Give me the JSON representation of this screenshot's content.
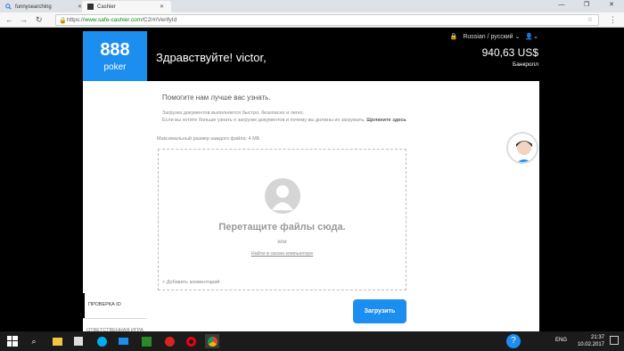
{
  "browser": {
    "tabs": [
      {
        "label": "funnysearching"
      },
      {
        "label": "Cashier"
      }
    ],
    "url_prefix": "https://",
    "url_host": "www.safe-cashier.com",
    "url_path": "/C2/#/VerifyId"
  },
  "header": {
    "greeting": "Здравствуйте! victor,",
    "language": "Russian / русский",
    "balance": "940,63 US$",
    "balance_label": "Банкролл",
    "logo_top": "888",
    "logo_bottom": "poker"
  },
  "sidebar": {
    "items": [
      {
        "label": "ПРОВЕРКА ID"
      },
      {
        "label": "ОТВЕТСТВЕННАЯ ИГРА"
      }
    ]
  },
  "main": {
    "title": "Помогите нам лучше вас узнать.",
    "info_line1": "Загрузка документов выполняется быстро, безопасно и легко.",
    "info_line2": "Если вы хотите больше узнать о загрузке документов и почему вы должны их загружать,",
    "info_link": "Щелкните здесь",
    "max_size": "Максимальный размер каждого файла: 4 МБ",
    "drop_title": "Перетащите файлы сюда.",
    "drop_or": "или",
    "drop_browse": "Найти в своем компьютере",
    "add_comment": "+ Добавить комментарий",
    "upload_button": "Загрузить"
  },
  "support": {
    "label": "Справка?"
  },
  "taskbar": {
    "language": "ENG",
    "time": "21:37",
    "date": "10.02.2017"
  }
}
